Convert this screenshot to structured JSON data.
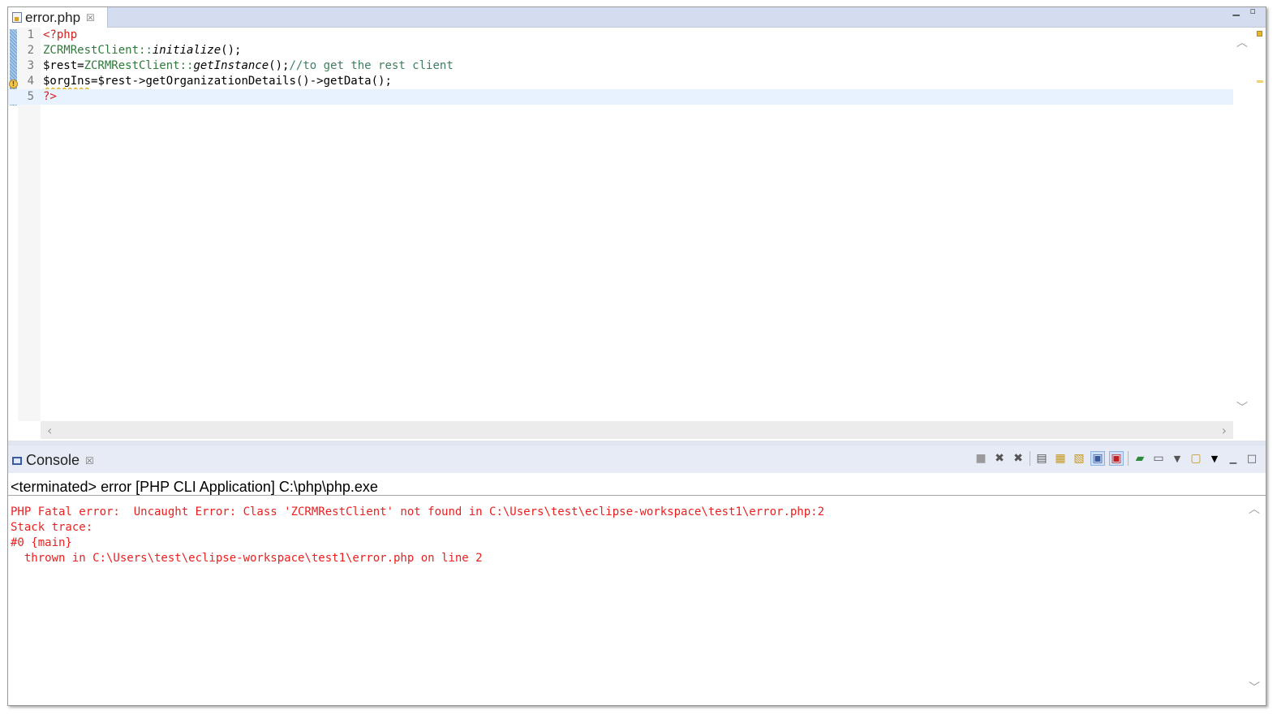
{
  "editor": {
    "tab_label": "error.php",
    "tab_close": "☒",
    "lines": [
      {
        "num": "1",
        "parts": [
          {
            "t": "<?php",
            "c": "php-tag"
          }
        ]
      },
      {
        "num": "2",
        "parts": [
          {
            "t": "ZCRMRestClient",
            "c": "cls"
          },
          {
            "t": "::",
            "c": "cls"
          },
          {
            "t": "initialize",
            "c": "ital"
          },
          {
            "t": "();",
            "c": "plain"
          }
        ]
      },
      {
        "num": "3",
        "parts": [
          {
            "t": "$rest=",
            "c": "plain"
          },
          {
            "t": "ZCRMRestClient",
            "c": "cls"
          },
          {
            "t": "::",
            "c": "cls"
          },
          {
            "t": "getInstance",
            "c": "ital"
          },
          {
            "t": "();",
            "c": "plain"
          },
          {
            "t": "//to get the rest client",
            "c": "cmt"
          }
        ]
      },
      {
        "num": "4",
        "parts": [
          {
            "t": "$orgIns",
            "c": "plain wavy"
          },
          {
            "t": "=$rest->getOrganizationDetails()->getData();",
            "c": "plain"
          }
        ]
      },
      {
        "num": "5",
        "parts": [
          {
            "t": "?>",
            "c": "php-tag"
          }
        ]
      }
    ]
  },
  "console": {
    "tab_label": "Console",
    "tab_close": "☒",
    "status": "<terminated> error [PHP CLI Application] C:\\php\\php.exe",
    "output": [
      "PHP Fatal error:  Uncaught Error: Class 'ZCRMRestClient' not found in C:\\Users\\test\\eclipse-workspace\\test1\\error.php:2",
      "Stack trace:",
      "#0 {main}",
      "  thrown in C:\\Users\\test\\eclipse-workspace\\test1\\error.php on line 2"
    ],
    "toolbar_icons": [
      "terminate-icon",
      "remove-launch-icon",
      "remove-all-terminated-icon",
      "clear-console-icon",
      "scroll-lock-icon",
      "word-wrap-icon",
      "show-on-stdout-icon",
      "show-on-stderr-icon",
      "pin-console-icon",
      "display-selected-console-icon",
      "display-selected-dropdown-icon",
      "open-console-icon",
      "open-console-dropdown-icon",
      "minimize-icon",
      "maximize-icon"
    ]
  },
  "colors": {
    "php_tag": "#d21f1f",
    "class_name": "#2f7a3b",
    "comment": "#3f7f5f",
    "error_text": "#ec1f1f",
    "current_line": "#e8f2fe"
  }
}
